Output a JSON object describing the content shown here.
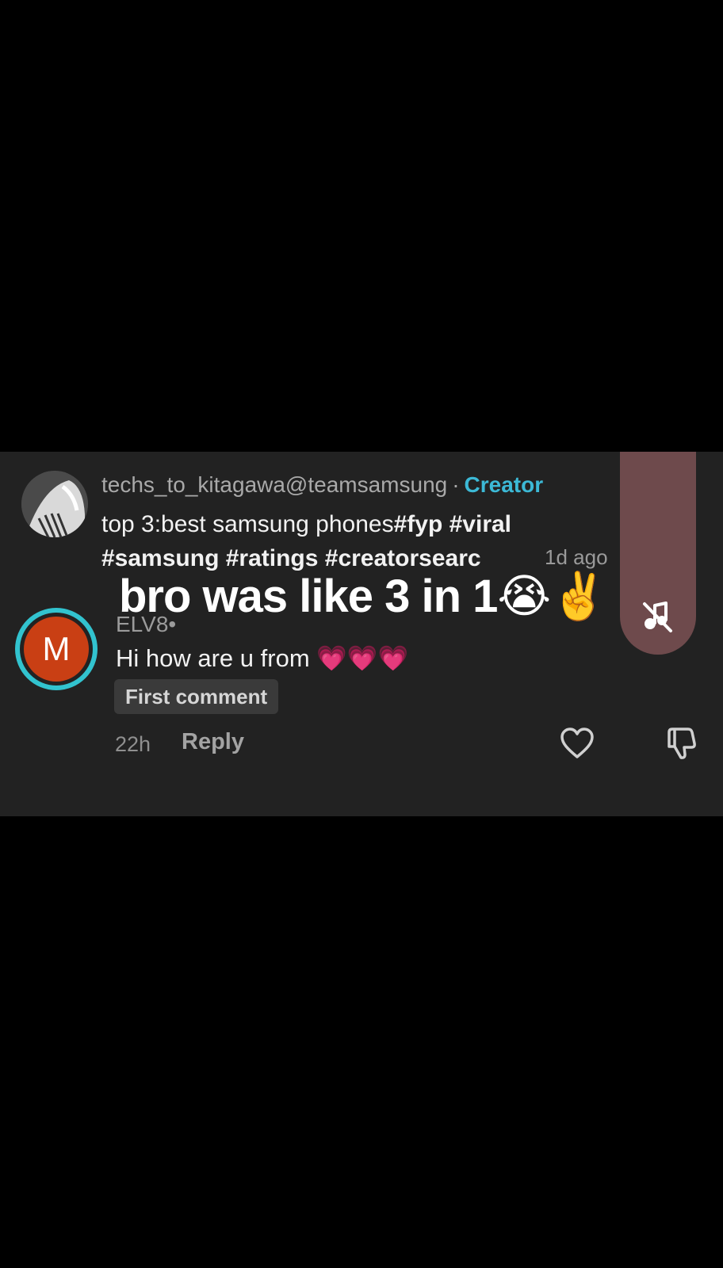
{
  "creator": {
    "username": "techs_to_kitagawa@teamsamsung",
    "separator": "·",
    "badge": "Creator",
    "caption_text": "top 3:best samsung phones",
    "caption_tags": "#fyp #viral #samsung #ratings #creatorsearc",
    "time": "1d ago"
  },
  "overlay": {
    "text": "bro was like 3 in 1😭✌️"
  },
  "music": {
    "icon": "music-muted-icon"
  },
  "comment": {
    "avatar_letter": "M",
    "username": "ELV8•",
    "text": "Hi how are u from 💗💗💗",
    "tag": "First comment",
    "time": "22h",
    "reply_label": "Reply"
  },
  "colors": {
    "background": "#000000",
    "panel": "#222222",
    "creator_badge": "#3cb9d6",
    "music_pill": "#6e4a4c",
    "avatar_ring": "#32c3cf",
    "avatar_fill": "#c93f14"
  }
}
